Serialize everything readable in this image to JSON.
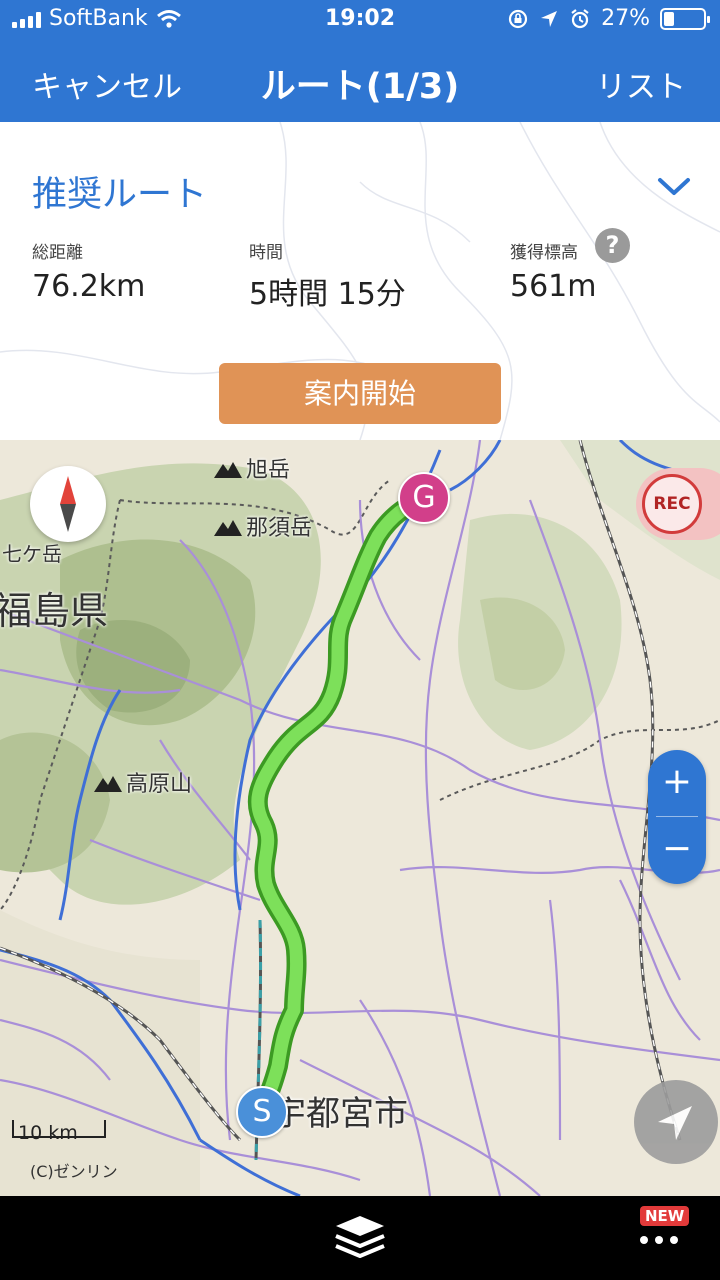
{
  "status_bar": {
    "carrier": "SoftBank",
    "time": "19:02",
    "battery": "27%",
    "battery_level": 0.27,
    "icons": [
      "signal-icon",
      "wifi-icon",
      "orientation-lock-icon",
      "location-icon",
      "alarm-icon",
      "battery-icon"
    ]
  },
  "navbar": {
    "cancel_label": "キャンセル",
    "title": "ルート(1/3)",
    "list_label": "リスト"
  },
  "route": {
    "name": "推奨ルート",
    "stats": {
      "distance_label": "総距離",
      "distance_value": "76.2km",
      "time_label": "時間",
      "time_value": "5時間 15分",
      "elevation_label": "獲得標高",
      "elevation_value": "561m"
    },
    "help_label": "?",
    "start_button": "案内開始"
  },
  "map": {
    "labels": {
      "asahidake": "旭岳",
      "nasudake": "那須岳",
      "shichigatake": "七ケ岳",
      "fukushima": "福島県",
      "takaharayama": "高原山",
      "utsunomiya": "宇都宮市"
    },
    "goal_marker": "G",
    "start_marker": "S",
    "rec_label": "REC",
    "zoom_in": "+",
    "zoom_out": "−",
    "scale": "10 km",
    "copyright": "(C)ゼンリン",
    "colors": {
      "route": "#7de05a",
      "route_outline": "#3c9a23",
      "goal": "#d23f8a",
      "start": "#4a90d9",
      "accent": "#2f76d2",
      "start_button": "#e09356"
    }
  },
  "bottom_bar": {
    "new_badge": "NEW",
    "icons": [
      "layers-icon",
      "more-icon"
    ]
  }
}
